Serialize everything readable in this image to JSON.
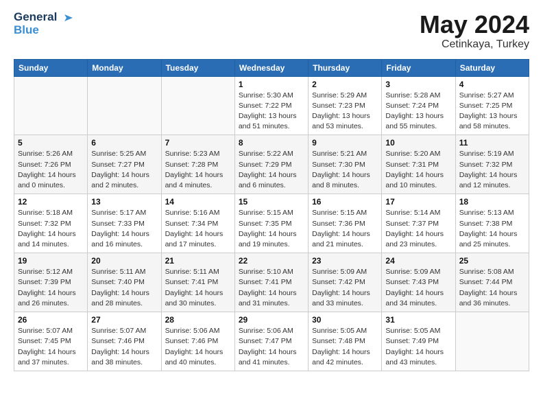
{
  "header": {
    "logo_line1": "General",
    "logo_line2": "Blue",
    "month": "May 2024",
    "location": "Cetinkaya, Turkey"
  },
  "weekdays": [
    "Sunday",
    "Monday",
    "Tuesday",
    "Wednesday",
    "Thursday",
    "Friday",
    "Saturday"
  ],
  "weeks": [
    [
      {
        "day": "",
        "info": ""
      },
      {
        "day": "",
        "info": ""
      },
      {
        "day": "",
        "info": ""
      },
      {
        "day": "1",
        "info": "Sunrise: 5:30 AM\nSunset: 7:22 PM\nDaylight: 13 hours\nand 51 minutes."
      },
      {
        "day": "2",
        "info": "Sunrise: 5:29 AM\nSunset: 7:23 PM\nDaylight: 13 hours\nand 53 minutes."
      },
      {
        "day": "3",
        "info": "Sunrise: 5:28 AM\nSunset: 7:24 PM\nDaylight: 13 hours\nand 55 minutes."
      },
      {
        "day": "4",
        "info": "Sunrise: 5:27 AM\nSunset: 7:25 PM\nDaylight: 13 hours\nand 58 minutes."
      }
    ],
    [
      {
        "day": "5",
        "info": "Sunrise: 5:26 AM\nSunset: 7:26 PM\nDaylight: 14 hours\nand 0 minutes."
      },
      {
        "day": "6",
        "info": "Sunrise: 5:25 AM\nSunset: 7:27 PM\nDaylight: 14 hours\nand 2 minutes."
      },
      {
        "day": "7",
        "info": "Sunrise: 5:23 AM\nSunset: 7:28 PM\nDaylight: 14 hours\nand 4 minutes."
      },
      {
        "day": "8",
        "info": "Sunrise: 5:22 AM\nSunset: 7:29 PM\nDaylight: 14 hours\nand 6 minutes."
      },
      {
        "day": "9",
        "info": "Sunrise: 5:21 AM\nSunset: 7:30 PM\nDaylight: 14 hours\nand 8 minutes."
      },
      {
        "day": "10",
        "info": "Sunrise: 5:20 AM\nSunset: 7:31 PM\nDaylight: 14 hours\nand 10 minutes."
      },
      {
        "day": "11",
        "info": "Sunrise: 5:19 AM\nSunset: 7:32 PM\nDaylight: 14 hours\nand 12 minutes."
      }
    ],
    [
      {
        "day": "12",
        "info": "Sunrise: 5:18 AM\nSunset: 7:32 PM\nDaylight: 14 hours\nand 14 minutes."
      },
      {
        "day": "13",
        "info": "Sunrise: 5:17 AM\nSunset: 7:33 PM\nDaylight: 14 hours\nand 16 minutes."
      },
      {
        "day": "14",
        "info": "Sunrise: 5:16 AM\nSunset: 7:34 PM\nDaylight: 14 hours\nand 17 minutes."
      },
      {
        "day": "15",
        "info": "Sunrise: 5:15 AM\nSunset: 7:35 PM\nDaylight: 14 hours\nand 19 minutes."
      },
      {
        "day": "16",
        "info": "Sunrise: 5:15 AM\nSunset: 7:36 PM\nDaylight: 14 hours\nand 21 minutes."
      },
      {
        "day": "17",
        "info": "Sunrise: 5:14 AM\nSunset: 7:37 PM\nDaylight: 14 hours\nand 23 minutes."
      },
      {
        "day": "18",
        "info": "Sunrise: 5:13 AM\nSunset: 7:38 PM\nDaylight: 14 hours\nand 25 minutes."
      }
    ],
    [
      {
        "day": "19",
        "info": "Sunrise: 5:12 AM\nSunset: 7:39 PM\nDaylight: 14 hours\nand 26 minutes."
      },
      {
        "day": "20",
        "info": "Sunrise: 5:11 AM\nSunset: 7:40 PM\nDaylight: 14 hours\nand 28 minutes."
      },
      {
        "day": "21",
        "info": "Sunrise: 5:11 AM\nSunset: 7:41 PM\nDaylight: 14 hours\nand 30 minutes."
      },
      {
        "day": "22",
        "info": "Sunrise: 5:10 AM\nSunset: 7:41 PM\nDaylight: 14 hours\nand 31 minutes."
      },
      {
        "day": "23",
        "info": "Sunrise: 5:09 AM\nSunset: 7:42 PM\nDaylight: 14 hours\nand 33 minutes."
      },
      {
        "day": "24",
        "info": "Sunrise: 5:09 AM\nSunset: 7:43 PM\nDaylight: 14 hours\nand 34 minutes."
      },
      {
        "day": "25",
        "info": "Sunrise: 5:08 AM\nSunset: 7:44 PM\nDaylight: 14 hours\nand 36 minutes."
      }
    ],
    [
      {
        "day": "26",
        "info": "Sunrise: 5:07 AM\nSunset: 7:45 PM\nDaylight: 14 hours\nand 37 minutes."
      },
      {
        "day": "27",
        "info": "Sunrise: 5:07 AM\nSunset: 7:46 PM\nDaylight: 14 hours\nand 38 minutes."
      },
      {
        "day": "28",
        "info": "Sunrise: 5:06 AM\nSunset: 7:46 PM\nDaylight: 14 hours\nand 40 minutes."
      },
      {
        "day": "29",
        "info": "Sunrise: 5:06 AM\nSunset: 7:47 PM\nDaylight: 14 hours\nand 41 minutes."
      },
      {
        "day": "30",
        "info": "Sunrise: 5:05 AM\nSunset: 7:48 PM\nDaylight: 14 hours\nand 42 minutes."
      },
      {
        "day": "31",
        "info": "Sunrise: 5:05 AM\nSunset: 7:49 PM\nDaylight: 14 hours\nand 43 minutes."
      },
      {
        "day": "",
        "info": ""
      }
    ]
  ]
}
